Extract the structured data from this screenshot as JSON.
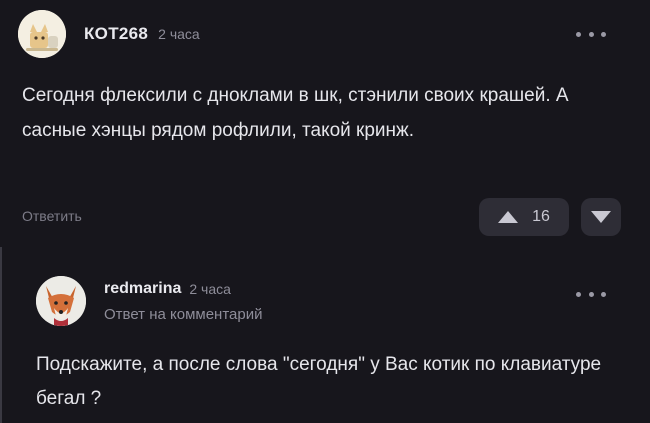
{
  "comment": {
    "author": "КОТ268",
    "time": "2 часа",
    "avatar_icon": "cat-avatar-icon",
    "body": "Сегодня флексили с дноклами в шк, стэнили своих крашей. А сасные хэнцы рядом рофлили, такой кринж.",
    "reply_label": "Ответить",
    "vote_count": "16"
  },
  "reply": {
    "author": "redmarina",
    "time": "2 часа",
    "avatar_icon": "fox-avatar-icon",
    "subtitle": "Ответ на комментарий",
    "body": "Подскажите, а после слова \"сегодня\" у Вас котик по клавиатуре бегал ?"
  },
  "colors": {
    "background": "#17161c",
    "text": "#e6e6eb",
    "muted": "#8e8d99",
    "vote_bg": "#2e2d36"
  }
}
